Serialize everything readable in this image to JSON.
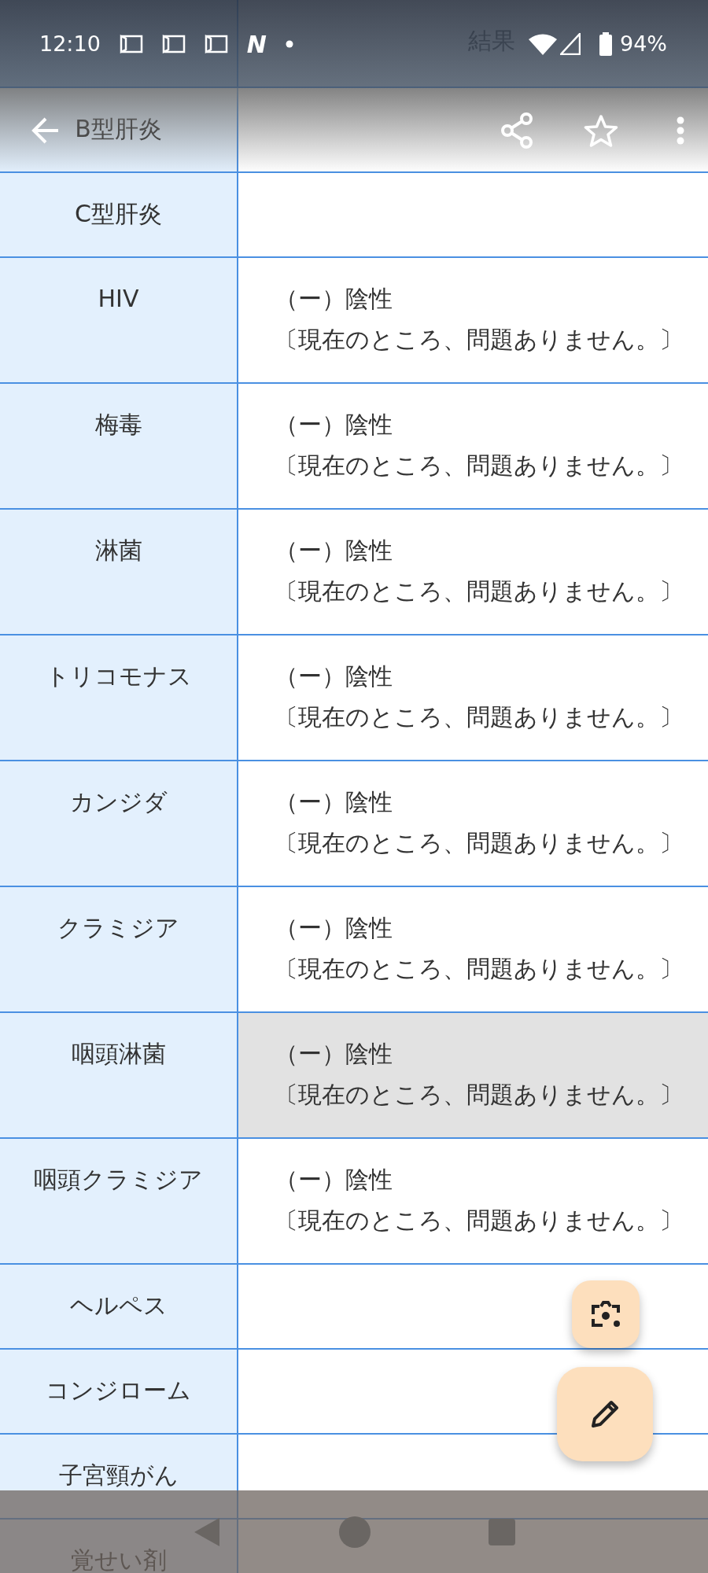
{
  "status_bar": {
    "time": "12:10",
    "app_badge": "N",
    "battery": "94%"
  },
  "table": {
    "result_header": "結果",
    "rows": [
      {
        "label": "B型肝炎"
      },
      {
        "label": "C型肝炎"
      },
      {
        "label": "HIV",
        "result": [
          "（ー）陰性",
          "〔現在のところ、問題ありません。〕"
        ],
        "selected": false
      },
      {
        "label": "梅毒",
        "result": [
          "（ー）陰性",
          "〔現在のところ、問題ありません。〕"
        ],
        "selected": false
      },
      {
        "label": "淋菌",
        "result": [
          "（ー）陰性",
          "〔現在のところ、問題ありません。〕"
        ],
        "selected": false
      },
      {
        "label": "トリコモナス",
        "result": [
          "（ー）陰性",
          "〔現在のところ、問題ありません。〕"
        ],
        "selected": false
      },
      {
        "label": "カンジダ",
        "result": [
          "（ー）陰性",
          "〔現在のところ、問題ありません。〕"
        ],
        "selected": false
      },
      {
        "label": "クラミジア",
        "result": [
          "（ー）陰性",
          "〔現在のところ、問題ありません。〕"
        ],
        "selected": false
      },
      {
        "label": "咽頭淋菌",
        "result": [
          "（ー）陰性",
          "〔現在のところ、問題ありません。〕"
        ],
        "selected": true
      },
      {
        "label": "咽頭クラミジア",
        "result": [
          "（ー）陰性",
          "〔現在のところ、問題ありません。〕"
        ],
        "selected": false
      },
      {
        "label": "ヘルペス"
      },
      {
        "label": "コンジローム"
      },
      {
        "label": "子宮頸がん"
      },
      {
        "label": "覚せい剤"
      }
    ]
  }
}
